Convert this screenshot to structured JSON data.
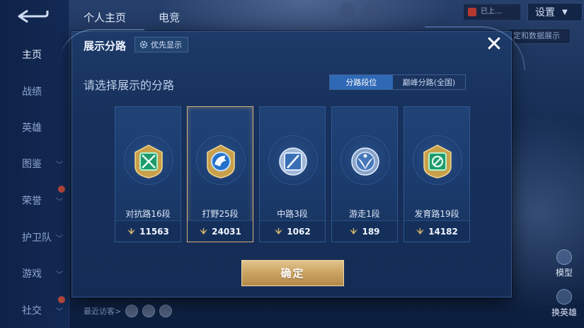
{
  "nav": {
    "items": [
      {
        "label": "主页",
        "active": true,
        "chevron": false
      },
      {
        "label": "战绩",
        "chevron": false
      },
      {
        "label": "英雄",
        "chevron": false
      },
      {
        "label": "图鉴",
        "chevron": true
      },
      {
        "label": "荣誉",
        "chevron": true
      },
      {
        "label": "护卫队",
        "chevron": true
      },
      {
        "label": "游戏",
        "chevron": true
      },
      {
        "label": "社交",
        "chevron": true
      }
    ]
  },
  "header": {
    "tabs": [
      "个人主页",
      "电竞"
    ],
    "settings_label": "设置",
    "status_text": "已上…",
    "chip_text": "定和数据展示"
  },
  "footer": {
    "visitors_label": "最近访客>"
  },
  "right_tools": {
    "model_label": "模型",
    "swap_label": "换英雄"
  },
  "dialog": {
    "title": "展示分路",
    "priority_label": "优先显示",
    "close_symbol": "✕",
    "prompt": "请选择展示的分路",
    "segment": {
      "options": [
        "分路段位",
        "巅峰分路(全国)"
      ],
      "selected": "分路段位"
    },
    "lanes": [
      {
        "label": "对抗路16段",
        "value": "11563",
        "badge_color": "#2fcf8a",
        "selected": false
      },
      {
        "label": "打野25段",
        "value": "24031",
        "badge_color": "#2f7fd6",
        "selected": true
      },
      {
        "label": "中路3段",
        "value": "1062",
        "badge_color": "#5d8fd0",
        "selected": false
      },
      {
        "label": "游走1段",
        "value": "189",
        "badge_color": "#6a9fd8",
        "selected": false
      },
      {
        "label": "发育路19段",
        "value": "14182",
        "badge_color": "#2ed39a",
        "selected": false
      }
    ],
    "confirm_label": "确定"
  },
  "colors": {
    "accent_blue": "#2f69b6",
    "gold": "#c9a261",
    "dialog_bg": "#17315d"
  }
}
